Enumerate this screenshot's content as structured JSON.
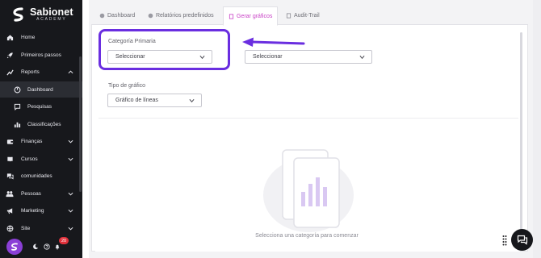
{
  "brand": {
    "name": "Sabionet",
    "subtitle": "ACADEMY"
  },
  "sidebar": {
    "items": [
      {
        "label": "Home",
        "icon": "home-icon"
      },
      {
        "label": "Primeiros passos",
        "icon": "rocket-icon"
      },
      {
        "label": "Reports",
        "icon": "chart-icon",
        "expanded": true
      },
      {
        "label": "Dashboard",
        "icon": "dashboard-icon",
        "active": true
      },
      {
        "label": "Pesquisas",
        "icon": "chat-icon"
      },
      {
        "label": "Classificações",
        "icon": "bar-chart-icon"
      },
      {
        "label": "Finanças",
        "icon": "wallet-icon"
      },
      {
        "label": "Cursos",
        "icon": "book-icon"
      },
      {
        "label": "comunidades",
        "icon": "community-icon"
      },
      {
        "label": "Pessoas",
        "icon": "people-icon"
      },
      {
        "label": "Marketing",
        "icon": "megaphone-icon"
      },
      {
        "label": "Site",
        "icon": "globe-icon"
      }
    ],
    "notification_count": "20"
  },
  "tabs": [
    {
      "label": "Dashboard",
      "icon": "clock-icon"
    },
    {
      "label": "Relatórios predefinidos",
      "icon": "clock-icon"
    },
    {
      "label": "Gerar gráficos",
      "icon": "document-icon",
      "active": true
    },
    {
      "label": "Audit-Trail",
      "icon": "document-icon"
    }
  ],
  "form": {
    "primary_label": "Categoría Primaria",
    "primary_value": "Seleccionar",
    "secondary_label": "",
    "secondary_value": "Seleccionar",
    "chart_type_label": "Tipo de gráfico",
    "chart_type_value": "Gráfico de líneas"
  },
  "empty_state": {
    "message": "Selecciona una categoría para comenzar"
  },
  "colors": {
    "accent": "#c83fc6",
    "highlight": "#6a2ee0",
    "sidebar_bg": "#17181c"
  }
}
